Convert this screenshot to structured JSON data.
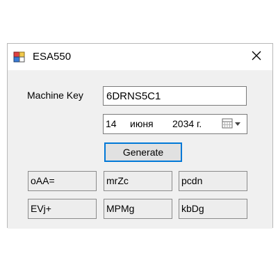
{
  "window": {
    "title": "ESA550",
    "close_icon": "close-icon",
    "app_icon": "app-icon"
  },
  "form": {
    "machine_key_label": "Machine Key",
    "machine_key_value": "6DRNS5C1",
    "date": {
      "day": "14",
      "month": "июня",
      "year": "2034 г."
    },
    "calendar_icon": "calendar-dropdown-icon",
    "generate_label": "Generate"
  },
  "results": [
    [
      "oAA=",
      "mrZc",
      "pcdn"
    ],
    [
      "EVj+",
      "MPMg",
      "kbDg"
    ]
  ],
  "colors": {
    "focus_border": "#0078d7",
    "window_bg": "#f0f0f0",
    "button_bg": "#e1e1e1"
  }
}
